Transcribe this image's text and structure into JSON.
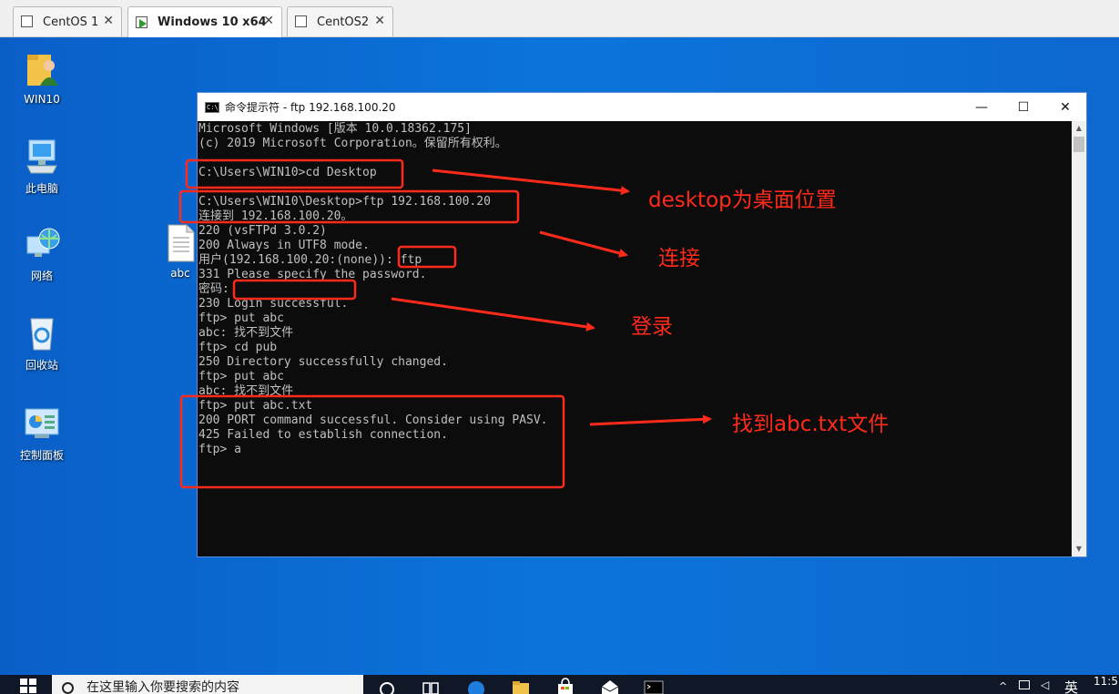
{
  "vm_tabs": [
    {
      "label": "CentOS 1",
      "active": false
    },
    {
      "label": "Windows 10 x64",
      "active": true
    },
    {
      "label": "CentOS2",
      "active": false
    }
  ],
  "vm_tab_close": "✕",
  "desktop_icons": [
    {
      "label": "WIN10",
      "icon": "user-folder-icon"
    },
    {
      "label": "此电脑",
      "icon": "computer-icon"
    },
    {
      "label": "网络",
      "icon": "network-icon"
    },
    {
      "label": "回收站",
      "icon": "recycle-bin-icon"
    },
    {
      "label": "控制面板",
      "icon": "control-panel-icon"
    },
    {
      "label": "abc",
      "icon": "text-file-icon"
    }
  ],
  "cmd": {
    "title": "命令提示符 - ftp  192.168.100.20",
    "icon_text": "C:\\",
    "minimize": "—",
    "maximize": "☐",
    "close": "✕",
    "lines": [
      "Microsoft Windows [版本 10.0.18362.175]",
      "(c) 2019 Microsoft Corporation。保留所有权利。",
      "",
      "C:\\Users\\WIN10>cd Desktop",
      "",
      "C:\\Users\\WIN10\\Desktop>ftp 192.168.100.20",
      "连接到 192.168.100.20。",
      "220 (vsFTPd 3.0.2)",
      "200 Always in UTF8 mode.",
      "用户(192.168.100.20:(none)): ftp",
      "331 Please specify the password.",
      "密码:",
      "230 Login successful.",
      "ftp> put abc",
      "abc: 找不到文件",
      "ftp> cd pub",
      "250 Directory successfully changed.",
      "ftp> put abc",
      "abc: 找不到文件",
      "ftp> put abc.txt",
      "200 PORT command successful. Consider using PASV.",
      "425 Failed to establish connection.",
      "ftp> a"
    ]
  },
  "annotations": {
    "color": "#ff2a1a",
    "notes": [
      "desktop为桌面位置",
      "连接",
      "登录",
      "找到abc.txt文件"
    ]
  },
  "taskbar": {
    "search_placeholder": "在这里输入你要搜索的内容",
    "clock": "11:5",
    "lang": "英",
    "icons": [
      "task-view-icon",
      "edge-icon",
      "file-explorer-icon",
      "store-icon",
      "mail-icon",
      "cmd-icon"
    ]
  }
}
